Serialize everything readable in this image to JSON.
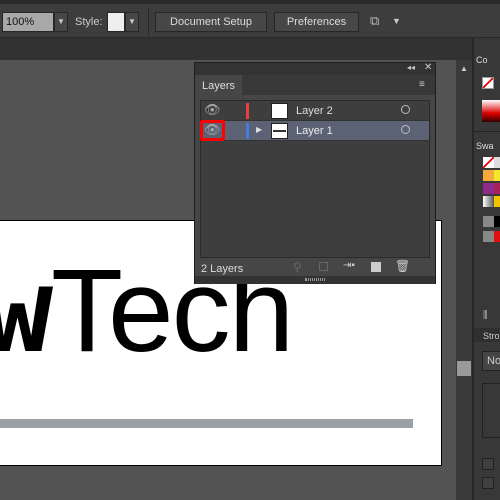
{
  "toolbar": {
    "zoom_value": "100%",
    "style_label": "Style:",
    "document_setup": "Document Setup",
    "preferences": "Preferences"
  },
  "layers_panel": {
    "tab": "Layers",
    "footer_count": "2 Layers",
    "layers": [
      {
        "name": "Layer 2",
        "color": "#e84040",
        "visible": true
      },
      {
        "name": "Layer 1",
        "color": "#4a7be0",
        "visible": true,
        "selected": true
      }
    ]
  },
  "artboard": {
    "text_bold": "w",
    "text": "Tech"
  },
  "right_panel": {
    "color_label": "Co",
    "swatches_label": "Swa",
    "stroke_label": "Stro",
    "stroke_value": "No"
  },
  "highlight_color": "#ff0000"
}
